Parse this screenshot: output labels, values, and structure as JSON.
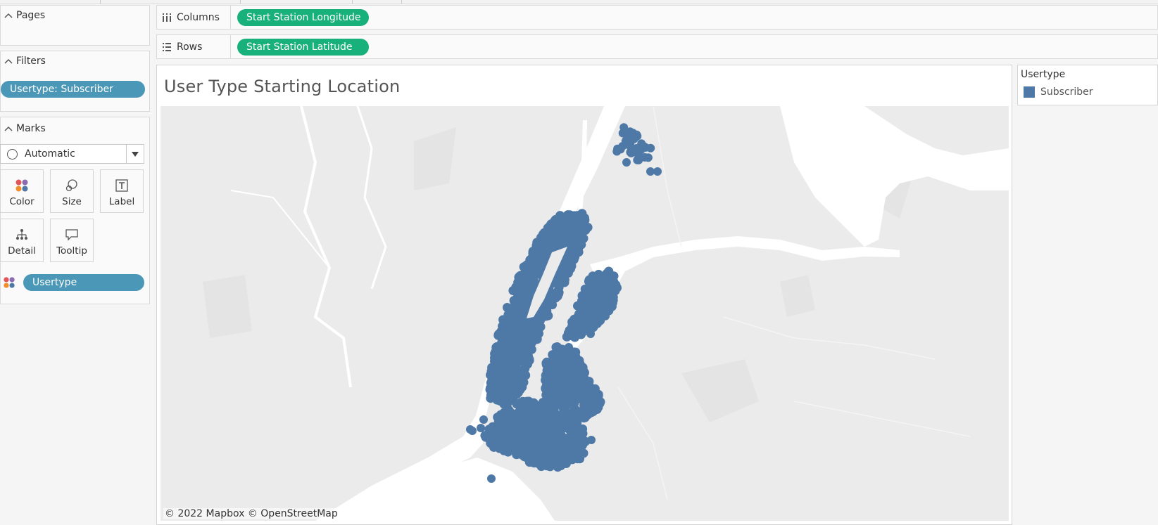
{
  "left_panel": {
    "pages": {
      "title": "Pages"
    },
    "filters": {
      "title": "Filters",
      "pills": [
        "Usertype: Subscriber"
      ]
    },
    "marks": {
      "title": "Marks",
      "mark_type": "Automatic",
      "buttons": {
        "color": "Color",
        "size": "Size",
        "label": "Label",
        "detail": "Detail",
        "tooltip": "Tooltip"
      },
      "fields": [
        {
          "icon": "color-dots-icon",
          "label": "Usertype"
        }
      ]
    }
  },
  "shelves": {
    "columns": {
      "label": "Columns",
      "pill": "Start Station Longitude"
    },
    "rows": {
      "label": "Rows",
      "pill": "Start Station Latitude"
    }
  },
  "view": {
    "title": "User Type Starting Location",
    "attribution": "© 2022 Mapbox  © OpenStreetMap"
  },
  "legend": {
    "title": "Usertype",
    "items": [
      {
        "label": "Subscriber",
        "color": "#4e79a7"
      }
    ]
  },
  "colors": {
    "mark": "#4e79a7",
    "filter_pill": "#4a97b7",
    "shelf_pill": "#18b07b",
    "water": "#ffffff",
    "land": "#ebebeb"
  }
}
